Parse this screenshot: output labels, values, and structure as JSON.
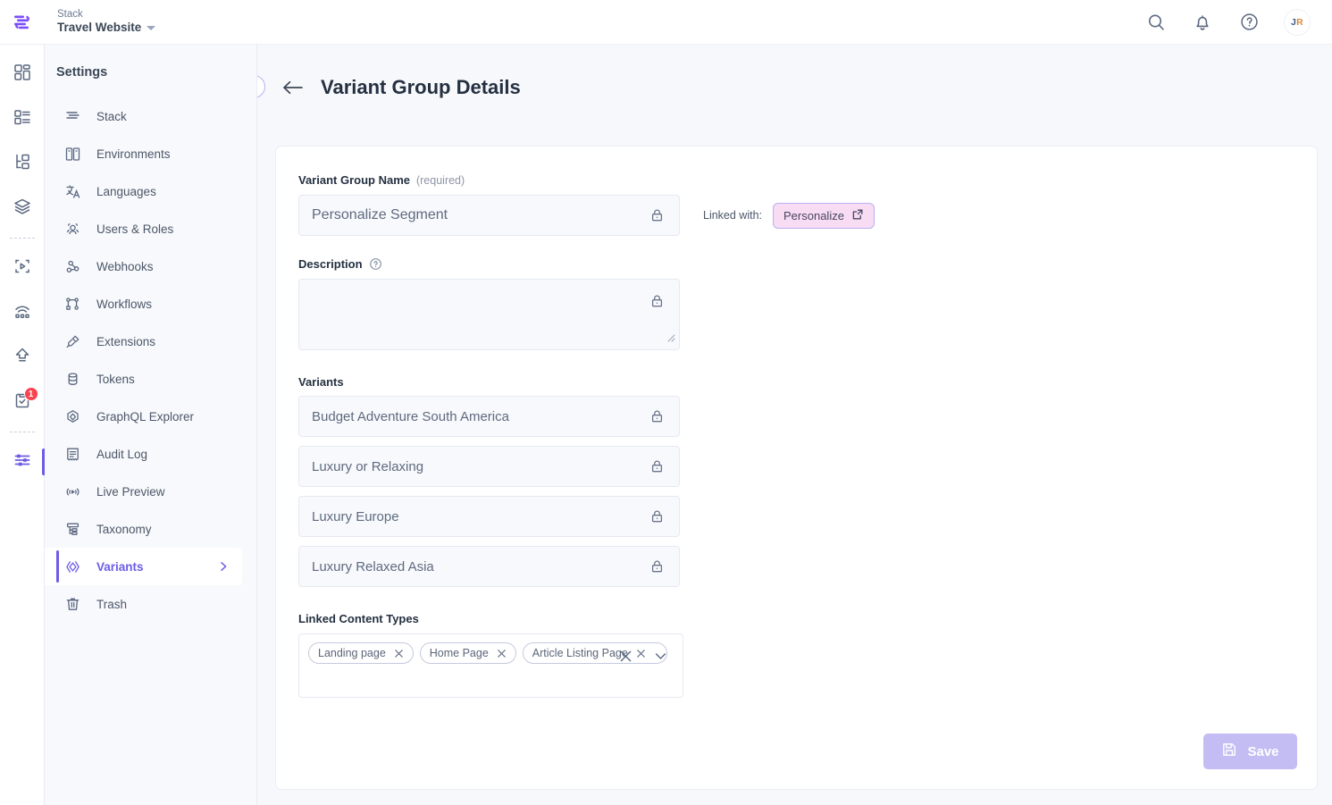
{
  "topbar": {
    "logo_icon": "contentstack-logo",
    "stack_label": "Stack",
    "stack_name": "Travel Website",
    "search_icon": "search-icon",
    "notifications_icon": "bell-icon",
    "help_icon": "help-circle-icon",
    "avatar_initials": "JR",
    "avatar_initial_first": "J",
    "avatar_initial_second": "R"
  },
  "rail": {
    "items": [
      {
        "icon": "dashboard-icon",
        "name": "dashboard"
      },
      {
        "icon": "content-types-icon",
        "name": "content-types"
      },
      {
        "icon": "entries-tree-icon",
        "name": "entries"
      },
      {
        "icon": "layers-icon",
        "name": "assets"
      },
      {
        "icon": "media-play-icon",
        "name": "media"
      },
      {
        "icon": "live-preview-icon",
        "name": "live-preview"
      },
      {
        "icon": "publish-upload-icon",
        "name": "publish-queue"
      },
      {
        "icon": "clipboard-check-icon",
        "name": "tasks",
        "badge": "1"
      },
      {
        "icon": "settings-sliders-icon",
        "name": "settings",
        "active": true
      }
    ]
  },
  "sidebar": {
    "title": "Settings",
    "items": [
      {
        "label": "Stack",
        "icon": "stack-icon"
      },
      {
        "label": "Environments",
        "icon": "environments-icon"
      },
      {
        "label": "Languages",
        "icon": "languages-icon"
      },
      {
        "label": "Users & Roles",
        "icon": "users-roles-icon"
      },
      {
        "label": "Webhooks",
        "icon": "webhooks-icon"
      },
      {
        "label": "Workflows",
        "icon": "workflows-icon"
      },
      {
        "label": "Extensions",
        "icon": "extensions-icon"
      },
      {
        "label": "Tokens",
        "icon": "tokens-icon"
      },
      {
        "label": "GraphQL Explorer",
        "icon": "graphql-icon"
      },
      {
        "label": "Audit Log",
        "icon": "audit-log-icon"
      },
      {
        "label": "Live Preview",
        "icon": "live-preview-icon"
      },
      {
        "label": "Taxonomy",
        "icon": "taxonomy-icon"
      },
      {
        "label": "Variants",
        "icon": "variants-icon",
        "active": true,
        "chevron": "chevron-right-icon"
      },
      {
        "label": "Trash",
        "icon": "trash-icon"
      }
    ]
  },
  "page": {
    "collapse_icon": "chevron-left-icon",
    "back_icon": "arrow-left-icon",
    "title": "Variant Group Details"
  },
  "form": {
    "name_label": "Variant Group Name",
    "name_required_hint": "(required)",
    "name_value": "Personalize Segment",
    "name_lock_icon": "lock-icon",
    "linked_with_label": "Linked with:",
    "linked_with_value": "Personalize",
    "linked_with_icon": "external-link-icon",
    "description_label": "Description",
    "description_help_icon": "question-circle-icon",
    "description_value": "",
    "description_placeholder": "",
    "description_lock_icon": "lock-icon",
    "variants_label": "Variants",
    "variants": [
      {
        "name": "Budget Adventure South America",
        "lock_icon": "lock-icon"
      },
      {
        "name": "Luxury or Relaxing",
        "lock_icon": "lock-icon"
      },
      {
        "name": "Luxury Europe",
        "lock_icon": "lock-icon"
      },
      {
        "name": "Luxury Relaxed Asia",
        "lock_icon": "lock-icon"
      }
    ],
    "linked_content_types_label": "Linked Content Types",
    "linked_content_types": [
      {
        "label": "Landing page",
        "remove_icon": "close-icon"
      },
      {
        "label": "Home Page",
        "remove_icon": "close-icon"
      },
      {
        "label": "Article Listing Page",
        "remove_icon": "close-icon"
      }
    ],
    "clear_all_icon": "close-icon",
    "dropdown_icon": "chevron-down-icon",
    "save_label": "Save",
    "save_icon": "save-disk-icon"
  },
  "colors": {
    "accent": "#6c5ce7",
    "save_button": "#c3bdf3",
    "pill_bg": "#f7dcf4",
    "pill_border": "#b9aff2",
    "badge": "#f9434f",
    "canvas": "#f7f8fb",
    "sidebar_bg": "#f8f9fc"
  }
}
